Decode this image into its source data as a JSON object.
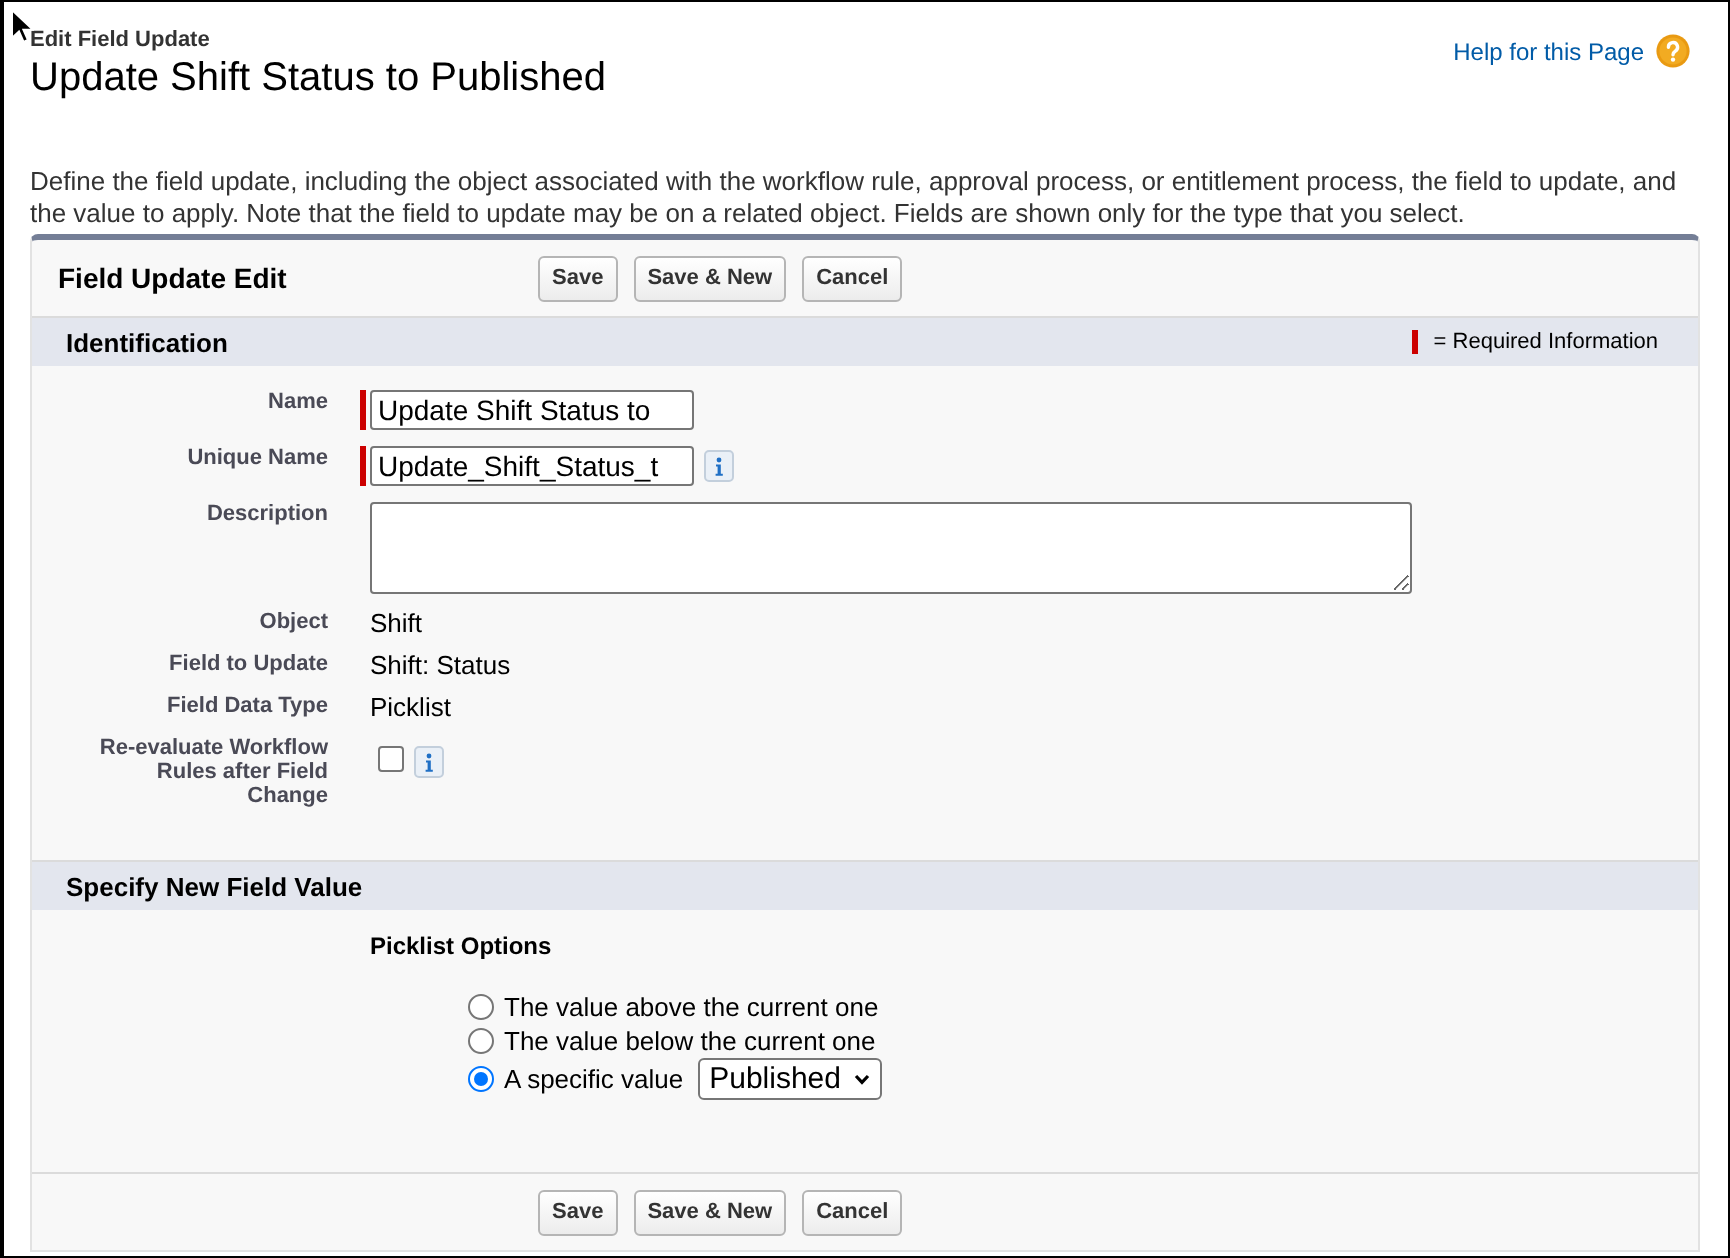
{
  "header": {
    "breadcrumb": "Edit Field Update",
    "title": "Update Shift Status to Published",
    "help_link": "Help for this Page"
  },
  "description": "Define the field update, including the object associated with the workflow rule, approval process, or entitlement process, the field to update, and the value to apply. Note that the field to update may be on a related object. Fields are shown only for the type that you select.",
  "panel": {
    "title": "Field Update Edit",
    "top_buttons": [
      "Save",
      "Save & New",
      "Cancel"
    ],
    "bottom_buttons": [
      "Save",
      "Save & New",
      "Cancel"
    ]
  },
  "sections": [
    {
      "title": "Identification",
      "legend": "= Required Information",
      "fields": [
        {
          "label": "Name",
          "kind": "text",
          "value": "Update Shift Status to",
          "required": true,
          "info": false
        },
        {
          "label": "Unique Name",
          "kind": "text",
          "value": "Update_Shift_Status_t",
          "required": true,
          "info": true
        },
        {
          "label": "Description",
          "kind": "textarea",
          "required": false,
          "info": false
        },
        {
          "label": "Object",
          "kind": "readonly",
          "value": "Shift",
          "required": false,
          "info": false
        },
        {
          "label": "Field to Update",
          "kind": "readonly",
          "value": "Shift: Status",
          "required": false,
          "info": false
        },
        {
          "label": "Field Data Type",
          "kind": "readonly",
          "value": "Picklist",
          "required": false,
          "info": false
        },
        {
          "label": "Re-evaluate Workflow Rules after Field Change",
          "kind": "checkbox",
          "checked": false,
          "required": false,
          "info": true
        }
      ]
    },
    {
      "title": "Specify New Field Value",
      "picklist": {
        "heading": "Picklist Options",
        "options": [
          {
            "label": "The value above the current one",
            "selected": false
          },
          {
            "label": "The value below the current one",
            "selected": false
          },
          {
            "label": "A specific value",
            "selected": true,
            "select_value": "Published"
          }
        ]
      }
    }
  ]
}
